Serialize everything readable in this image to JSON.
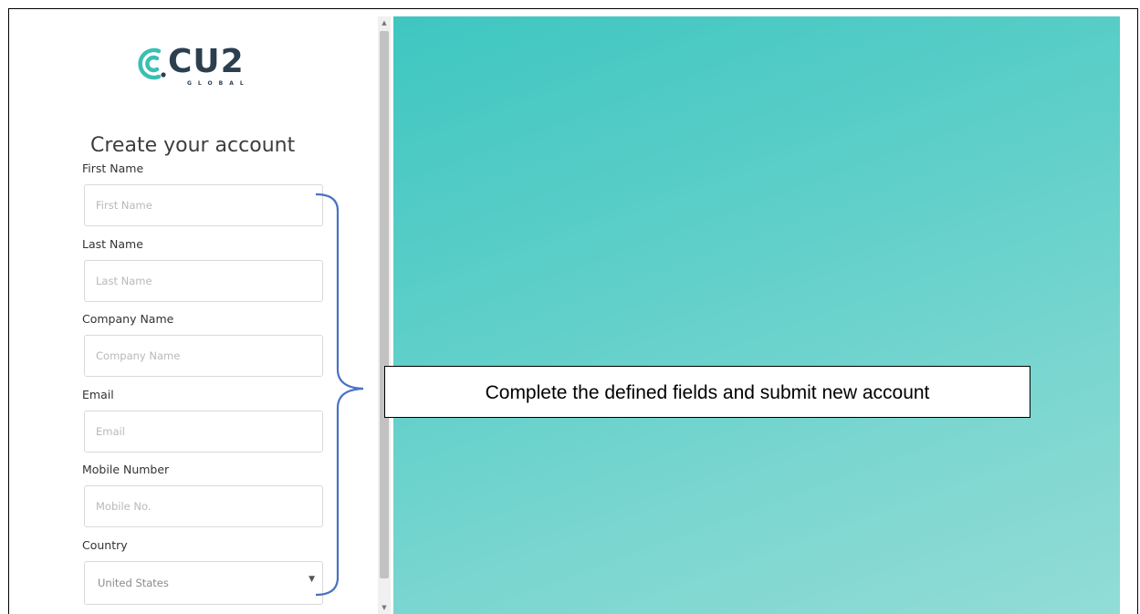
{
  "brand": {
    "name": "CU2",
    "sub": "GLOBAL",
    "accent_color": "#3bbfb5",
    "text_color": "#2c3f4f",
    "icon": "cu2-logo-icon"
  },
  "form": {
    "title": "Create your account",
    "fields": [
      {
        "label": "First Name",
        "placeholder": "First Name"
      },
      {
        "label": "Last Name",
        "placeholder": "Last Name"
      },
      {
        "label": "Company Name",
        "placeholder": "Company Name"
      },
      {
        "label": "Email",
        "placeholder": "Email"
      },
      {
        "label": "Mobile Number",
        "placeholder": "Mobile No."
      }
    ],
    "country": {
      "label": "Country",
      "value": "United States",
      "caret_icon": "caret-down-icon"
    }
  },
  "annotation": {
    "text": "Complete the defined fields and submit new account",
    "bracket_color": "#4a72c4"
  },
  "hero": {
    "color_start": "#3fc6c1",
    "color_end": "#92dcd6"
  },
  "scrollbar": {
    "up_icon": "scroll-up-arrow-icon",
    "down_icon": "scroll-down-arrow-icon"
  }
}
